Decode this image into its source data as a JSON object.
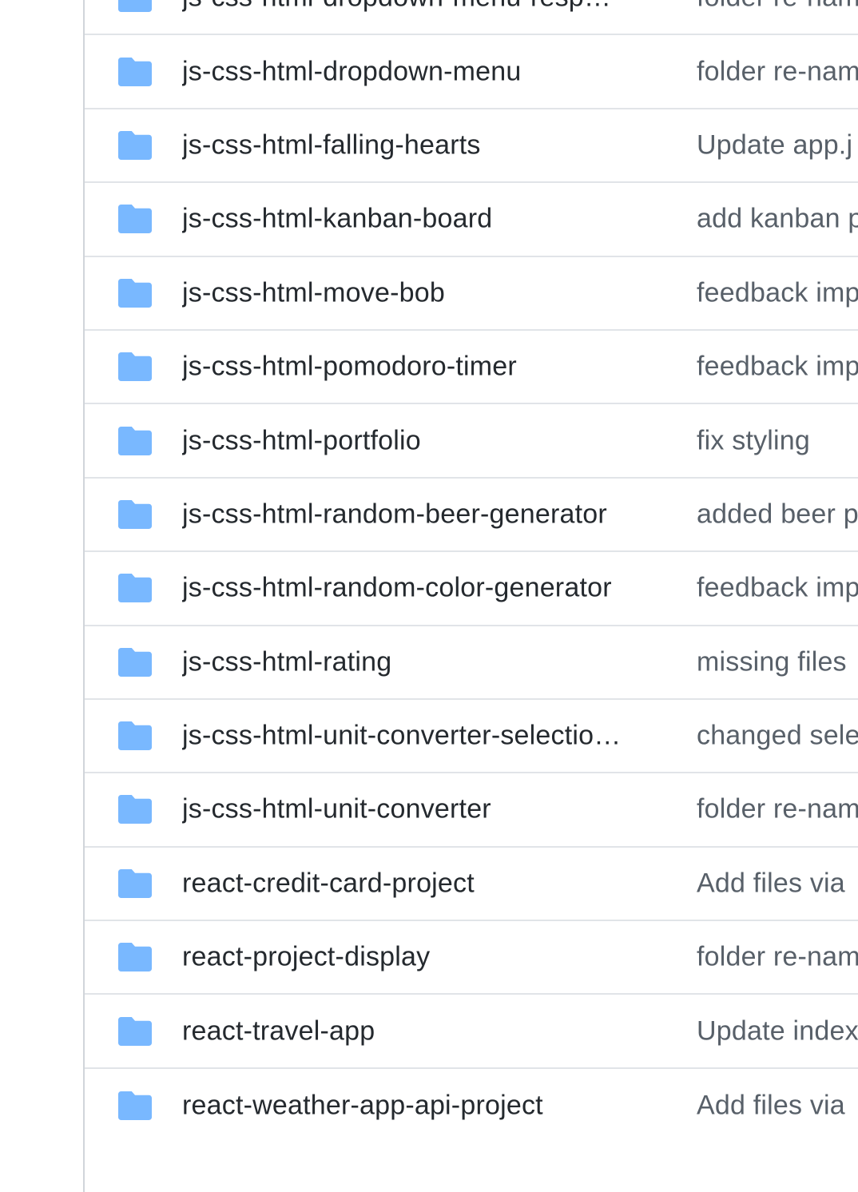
{
  "colors": {
    "folder_icon": "#79b8ff",
    "name_text": "#24292e",
    "message_text": "#586069",
    "row_border": "#e1e4e8"
  },
  "rows": [
    {
      "icon": "folder-icon",
      "name": "js-css-html-dropdown-menu-resp…",
      "message": "folder re-nam"
    },
    {
      "icon": "folder-icon",
      "name": "js-css-html-dropdown-menu",
      "message": "folder re-nam"
    },
    {
      "icon": "folder-icon",
      "name": "js-css-html-falling-hearts",
      "message": "Update app.j"
    },
    {
      "icon": "folder-icon",
      "name": "js-css-html-kanban-board",
      "message": "add kanban p"
    },
    {
      "icon": "folder-icon",
      "name": "js-css-html-move-bob",
      "message": "feedback imp"
    },
    {
      "icon": "folder-icon",
      "name": "js-css-html-pomodoro-timer",
      "message": "feedback imp"
    },
    {
      "icon": "folder-icon",
      "name": "js-css-html-portfolio",
      "message": "fix styling"
    },
    {
      "icon": "folder-icon",
      "name": "js-css-html-random-beer-generator",
      "message": "added beer p"
    },
    {
      "icon": "folder-icon",
      "name": "js-css-html-random-color-generator",
      "message": "feedback imp"
    },
    {
      "icon": "folder-icon",
      "name": "js-css-html-rating",
      "message": "missing files"
    },
    {
      "icon": "folder-icon",
      "name": "js-css-html-unit-converter-selectio…",
      "message": "changed sele"
    },
    {
      "icon": "folder-icon",
      "name": "js-css-html-unit-converter",
      "message": "folder re-nam"
    },
    {
      "icon": "folder-icon",
      "name": "react-credit-card-project",
      "message": "Add files via"
    },
    {
      "icon": "folder-icon",
      "name": "react-project-display",
      "message": "folder re-nam"
    },
    {
      "icon": "folder-icon",
      "name": "react-travel-app",
      "message": "Update index"
    },
    {
      "icon": "folder-icon",
      "name": "react-weather-app-api-project",
      "message": "Add files via"
    }
  ]
}
